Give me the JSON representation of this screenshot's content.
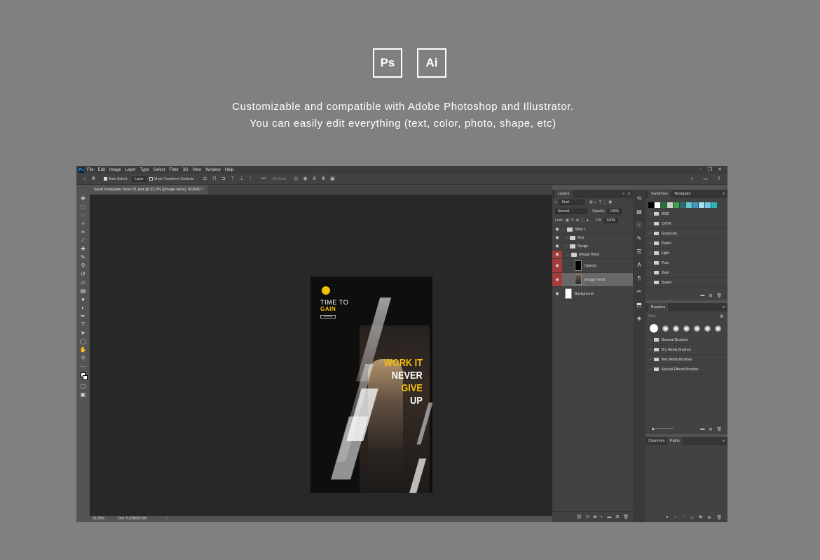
{
  "header": {
    "badge_ps": "Ps",
    "badge_ai": "Ai",
    "line1": "Customizable and compatible with Adobe Photoshop and Illustrator.",
    "line2": "You can easily edit everything (text, color, photo, shape, etc)"
  },
  "ps": {
    "logo": "Ps",
    "menus": [
      "File",
      "Edit",
      "Image",
      "Layer",
      "Type",
      "Select",
      "Filter",
      "3D",
      "View",
      "Window",
      "Help"
    ],
    "options": {
      "auto_select": "Auto-Select:",
      "layer_select": "Layer",
      "transform": "Show Transform Controls",
      "mode_3d": "3D Mode:"
    },
    "doc_tab": "Sport Instagram Story 01.psd @ 33,3% ([Image Here], RGB/8) *",
    "status": {
      "zoom": "33,33%",
      "doc": "Doc: 5,93M/92,0M"
    },
    "document": {
      "title1": "TIME TO",
      "title2": "GAIN",
      "button": "JOIN NOW",
      "headline": [
        "WORK IT",
        "NEVER",
        "GIVE",
        "UP"
      ],
      "colors": {
        "accent": "#f4c20d",
        "white": "#ffffff"
      }
    },
    "layers": {
      "tab": "Layers",
      "kind": "Kind",
      "blend": "Normal",
      "opacity_label": "Opacity:",
      "opacity": "100%",
      "lock_label": "Lock:",
      "fill_label": "Fill:",
      "fill": "100%",
      "rows": [
        {
          "name": "Story 1",
          "type": "group"
        },
        {
          "name": "Text",
          "type": "group"
        },
        {
          "name": "Design",
          "type": "group"
        },
        {
          "name": "[Image Here]",
          "type": "group"
        },
        {
          "name": "Opacity",
          "type": "layer"
        },
        {
          "name": "[Image Here]",
          "type": "layer"
        },
        {
          "name": "Background",
          "type": "layer"
        }
      ]
    },
    "swatches": {
      "tabs": [
        "Swatches",
        "Navigator"
      ],
      "colors": [
        "#000000",
        "#ffffff",
        "#1b7a3b",
        "#cfcfcf",
        "#3fa34d",
        "#2b6b6b",
        "#67c6c9",
        "#3e9ac4",
        "#a8e0f0",
        "#74c7e8",
        "#29b6b0"
      ],
      "groups": [
        "RGB",
        "CMYK",
        "Grayscale",
        "Pastel",
        "Light",
        "Pure",
        "Dark",
        "Darker"
      ]
    },
    "brushes": {
      "tab": "Brushes",
      "size_label": "Size:",
      "groups": [
        "General Brushes",
        "Dry Media Brushes",
        "Wet Media Brushes",
        "Special Effects Brushes"
      ]
    },
    "paths": {
      "tabs": [
        "Channels",
        "Paths"
      ]
    }
  }
}
